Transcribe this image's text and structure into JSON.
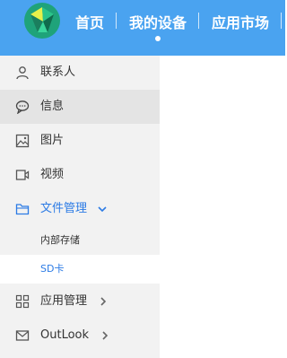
{
  "header": {
    "nav": [
      {
        "label": "首页"
      },
      {
        "label": "我的设备"
      },
      {
        "label": "应用市场"
      }
    ]
  },
  "sidebar": {
    "items": [
      {
        "label": "联系人",
        "icon": "person-icon"
      },
      {
        "label": "信息",
        "icon": "message-icon",
        "selected": true
      },
      {
        "label": "图片",
        "icon": "image-icon"
      },
      {
        "label": "视频",
        "icon": "video-icon"
      },
      {
        "label": "文件管理",
        "icon": "folder-icon",
        "expanded": true,
        "accent": "#2c7be5"
      },
      {
        "label": "应用管理",
        "icon": "apps-grid-icon"
      },
      {
        "label": "OutLook",
        "icon": "mail-icon"
      }
    ],
    "file_sub": [
      {
        "label": "内部存储"
      },
      {
        "label": "SD卡",
        "current": true
      }
    ]
  },
  "colors": {
    "header_bg": "#4aa3f0",
    "sidebar_bg": "#f2f2f2",
    "accent": "#2c7be5"
  }
}
